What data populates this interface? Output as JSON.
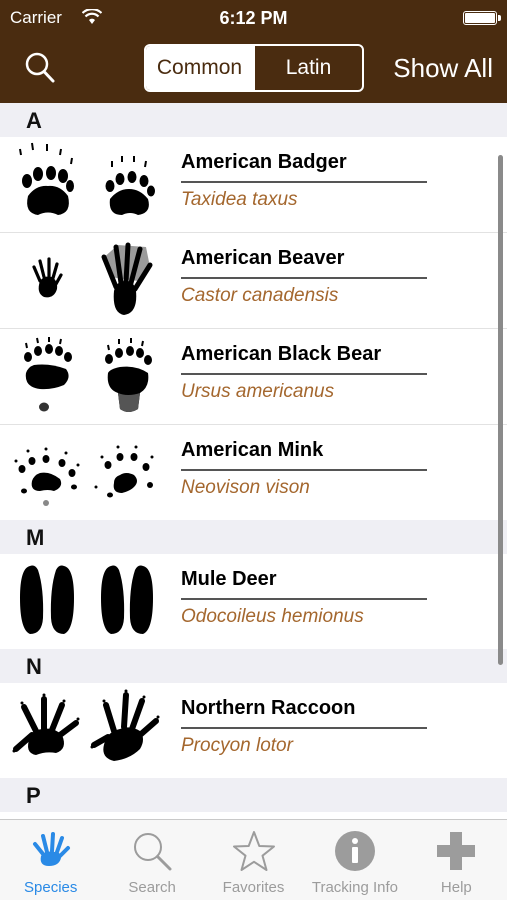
{
  "status": {
    "carrier": "Carrier",
    "time": "6:12 PM"
  },
  "nav": {
    "segment_common": "Common",
    "segment_latin": "Latin",
    "show_all": "Show All"
  },
  "sections": {
    "a": "A",
    "m": "M",
    "n": "N",
    "p": "P"
  },
  "species": [
    {
      "name": "American Badger",
      "latin": "Taxidea taxus"
    },
    {
      "name": "American Beaver",
      "latin": "Castor canadensis"
    },
    {
      "name": "American Black Bear",
      "latin": "Ursus americanus"
    },
    {
      "name": "American Mink",
      "latin": "Neovison vison"
    },
    {
      "name": "Mule Deer",
      "latin": "Odocoileus hemionus"
    },
    {
      "name": "Northern Raccoon",
      "latin": "Procyon lotor"
    }
  ],
  "tabs": [
    {
      "label": "Species",
      "icon": "paw-icon",
      "active": true
    },
    {
      "label": "Search",
      "icon": "magnifier-icon"
    },
    {
      "label": "Favorites",
      "icon": "star-icon"
    },
    {
      "label": "Tracking Info",
      "icon": "info-icon"
    },
    {
      "label": "Help",
      "icon": "plus-icon"
    }
  ],
  "colors": {
    "nav_bg": "#4a2c10",
    "latin_text": "#a4672e",
    "active_tab": "#2a8ae6"
  }
}
